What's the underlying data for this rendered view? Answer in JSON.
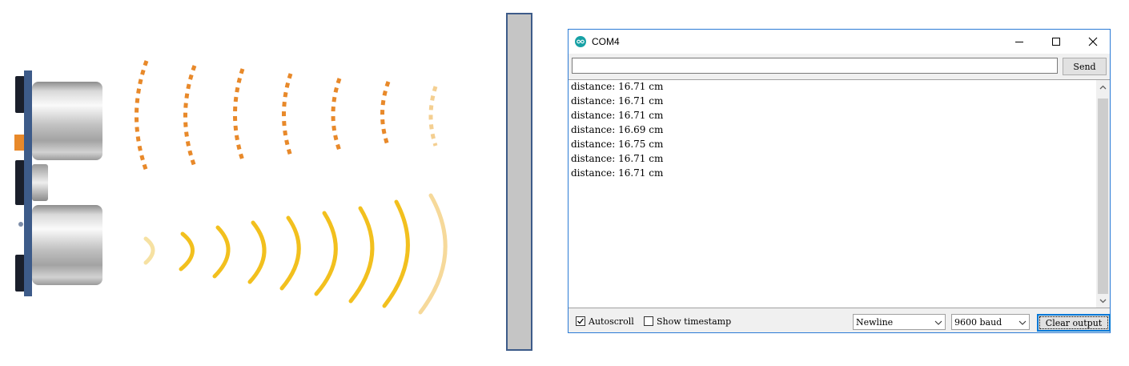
{
  "window": {
    "title": "COM4",
    "accent": "#2b7bd6"
  },
  "send_bar": {
    "input_value": "",
    "send_label": "Send"
  },
  "output": {
    "lines": [
      "distance: 16.71 cm",
      "distance: 16.71 cm",
      "distance: 16.71 cm",
      "distance: 16.69 cm",
      "distance: 16.75 cm",
      "distance: 16.71 cm",
      "distance: 16.71 cm"
    ]
  },
  "bottom": {
    "autoscroll_label": "Autoscroll",
    "autoscroll_checked": true,
    "timestamp_label": "Show timestamp",
    "timestamp_checked": false,
    "line_ending": "Newline",
    "baud_rate": "9600 baud",
    "clear_label": "Clear output"
  },
  "illustration": {
    "sensor": "ultrasonic-sensor",
    "obstacle": "wall",
    "emitted_wave_color": "#e8892a",
    "echo_wave_color": "#f2c01e"
  }
}
